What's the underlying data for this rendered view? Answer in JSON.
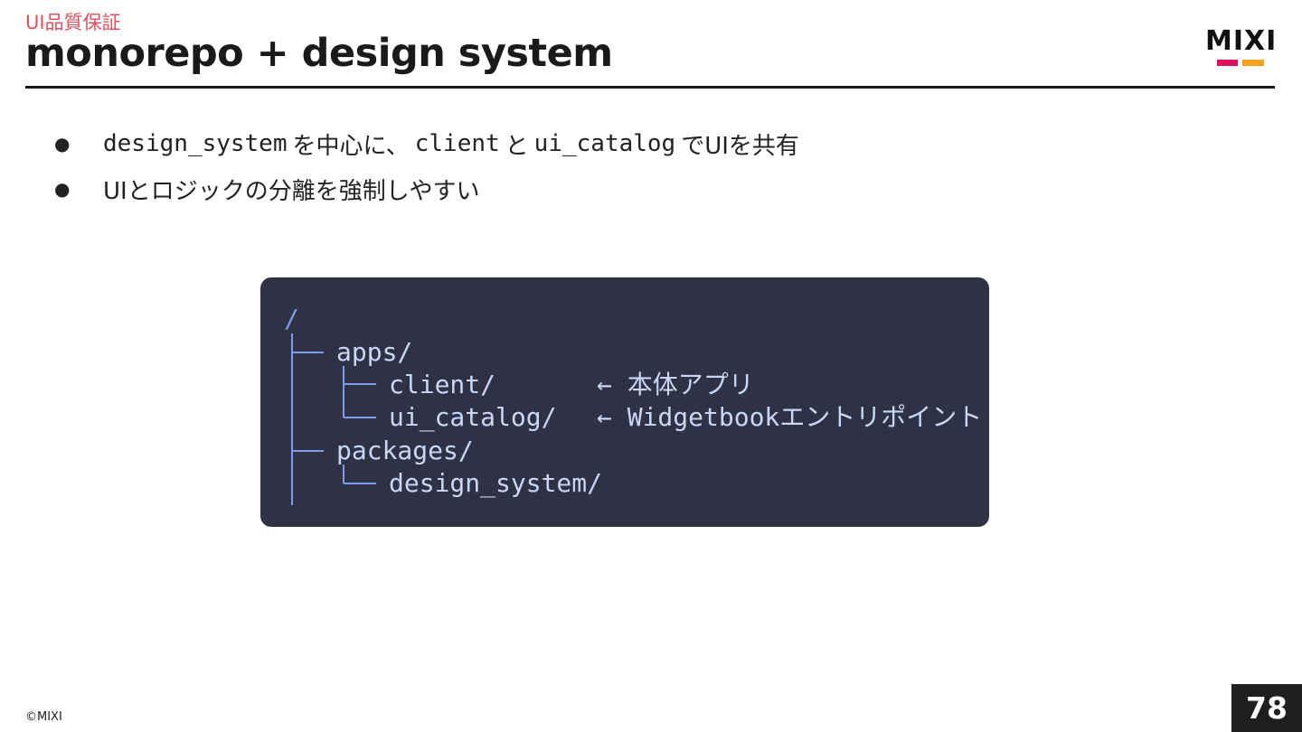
{
  "header": {
    "kicker": "UI品質保証",
    "title": "monorepo + design system"
  },
  "logo": {
    "text": "MIXI",
    "colors": {
      "red": "#e0105a",
      "orange": "#f5a21a"
    }
  },
  "bullets": [
    {
      "parts": [
        {
          "type": "code",
          "text": "design_system"
        },
        {
          "type": "text",
          "text": "を中心に、"
        },
        {
          "type": "code",
          "text": "client"
        },
        {
          "type": "text",
          "text": "と"
        },
        {
          "type": "code",
          "text": "ui_catalog"
        },
        {
          "type": "text",
          "text": "でUIを共有"
        }
      ]
    },
    {
      "parts": [
        {
          "type": "text",
          "text": "UIとロジックの分離を強制しやすい"
        }
      ]
    }
  ],
  "tree": {
    "root": "/",
    "apps": "apps/",
    "client": "client/",
    "ui_catalog": "ui_catalog/",
    "packages": "packages/",
    "design_system": "design_system/",
    "client_note": "← 本体アプリ",
    "ui_catalog_note": "← Widgetbookエントリポイント",
    "colors": {
      "background": "#2f3245",
      "text": "#c9d6f5",
      "lines": "#7d9ce8"
    }
  },
  "footer": {
    "copyright": "©MIXI",
    "page": "78"
  }
}
